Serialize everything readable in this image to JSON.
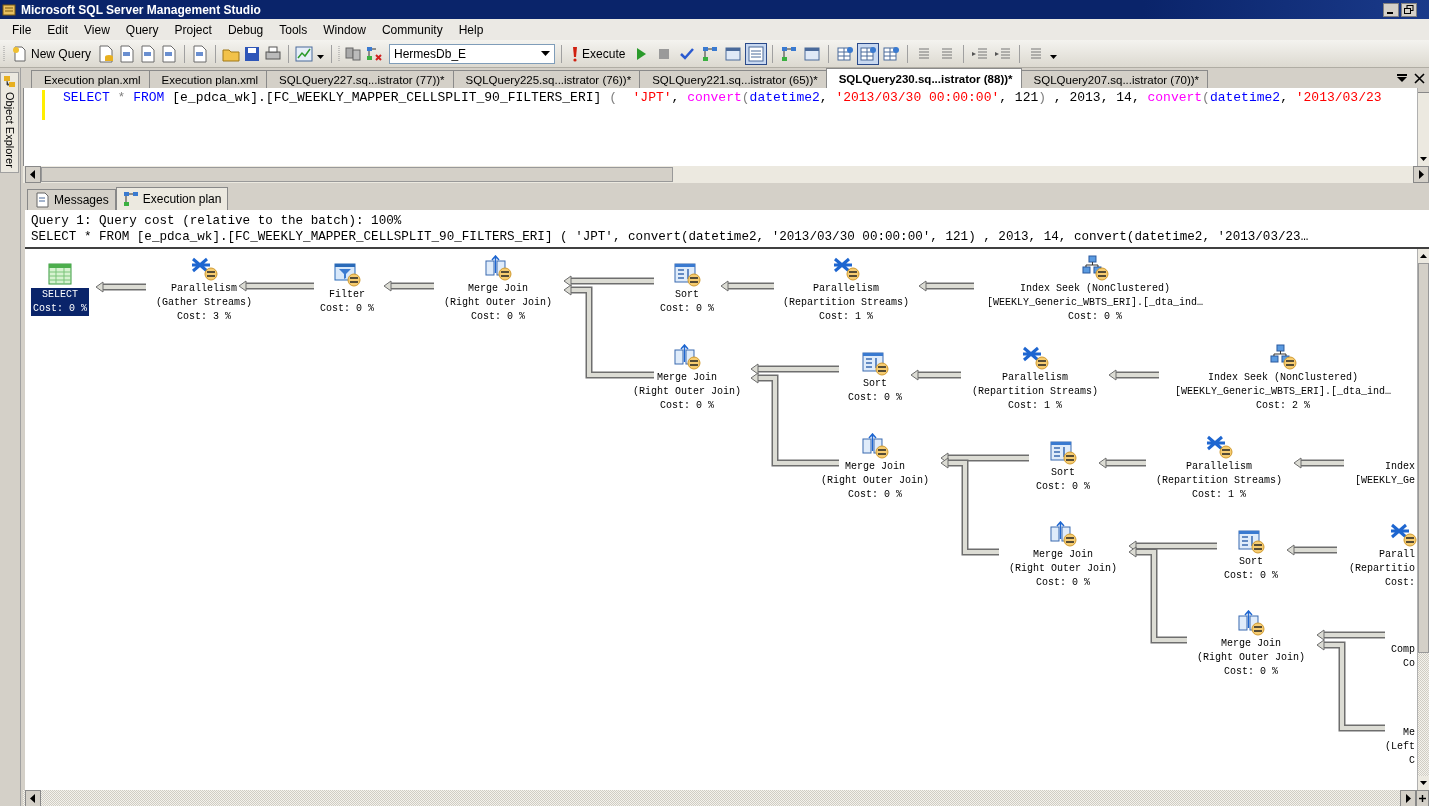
{
  "window": {
    "title": "Microsoft SQL Server Management Studio"
  },
  "menu": [
    "File",
    "Edit",
    "View",
    "Query",
    "Project",
    "Debug",
    "Tools",
    "Window",
    "Community",
    "Help"
  ],
  "toolbar": {
    "new_query": "New Query",
    "database": "HermesDb_E",
    "execute": "Execute"
  },
  "side_panel": {
    "label": "Object Explorer"
  },
  "document_tabs": [
    {
      "label": "Execution plan.xml",
      "selected": false
    },
    {
      "label": "Execution plan.xml",
      "selected": false
    },
    {
      "label": "SQLQuery227.sq...istrator (77))*",
      "selected": false
    },
    {
      "label": "SQLQuery225.sq...istrator (76))*",
      "selected": false
    },
    {
      "label": "SQLQuery221.sq...istrator (65))*",
      "selected": false
    },
    {
      "label": "SQLQuery230.sq...istrator (88))*",
      "selected": true
    },
    {
      "label": "SQLQuery207.sq...istrator (70))*",
      "selected": false
    }
  ],
  "editor": {
    "tokens": [
      {
        "kind": "keyword",
        "text": "SELECT"
      },
      {
        "kind": "operator",
        "text": " * "
      },
      {
        "kind": "keyword",
        "text": "FROM"
      },
      {
        "kind": "plain",
        "text": " [e_pdca_wk].[FC_WEEKLY_MAPPER_CELLSPLIT_90_FILTERS_ERI] "
      },
      {
        "kind": "operator",
        "text": "(  "
      },
      {
        "kind": "string",
        "text": "'JPT'"
      },
      {
        "kind": "plain",
        "text": ", "
      },
      {
        "kind": "function",
        "text": "convert"
      },
      {
        "kind": "operator",
        "text": "("
      },
      {
        "kind": "keyword",
        "text": "datetime2"
      },
      {
        "kind": "plain",
        "text": ", "
      },
      {
        "kind": "string",
        "text": "'2013/03/30 00:00:00'"
      },
      {
        "kind": "plain",
        "text": ", 121"
      },
      {
        "kind": "operator",
        "text": ")"
      },
      {
        "kind": "plain",
        "text": " , 2013, 14, "
      },
      {
        "kind": "function",
        "text": "convert"
      },
      {
        "kind": "operator",
        "text": "("
      },
      {
        "kind": "keyword",
        "text": "datetime2"
      },
      {
        "kind": "plain",
        "text": ", "
      },
      {
        "kind": "string",
        "text": "'2013/03/23"
      }
    ]
  },
  "result_tabs": [
    {
      "label": "Messages",
      "selected": false
    },
    {
      "label": "Execution plan",
      "selected": true
    }
  ],
  "plan": {
    "header": "Query 1: Query cost (relative to the batch): 100%",
    "statement": "SELECT * FROM [e_pdca_wk].[FC_WEEKLY_MAPPER_CELLSPLIT_90_FILTERS_ERI] ( 'JPT', convert(datetime2, '2013/03/30 00:00:00', 121) , 2013, 14, convert(datetime2, '2013/03/23…",
    "nodes": [
      {
        "kind": "select",
        "name": "SELECT",
        "cost": "Cost: 0 %",
        "selected": true,
        "clipped": false
      },
      {
        "kind": "parallelism",
        "name": "Parallelism",
        "detail": "(Gather Streams)",
        "cost": "Cost: 3 %",
        "selected": false,
        "clipped": false
      },
      {
        "kind": "filter",
        "name": "Filter",
        "cost": "Cost: 0 %",
        "selected": false,
        "clipped": false
      },
      {
        "kind": "merge-join",
        "name": "Merge Join",
        "detail": "(Right Outer Join)",
        "cost": "Cost: 0 %",
        "selected": false,
        "clipped": false
      },
      {
        "kind": "sort",
        "name": "Sort",
        "cost": "Cost: 0 %",
        "selected": false,
        "clipped": false
      },
      {
        "kind": "parallelism",
        "name": "Parallelism",
        "detail": "(Repartition Streams)",
        "cost": "Cost: 1 %",
        "selected": false,
        "clipped": false
      },
      {
        "kind": "index-seek",
        "name": "Index Seek (NonClustered)",
        "detail": "[WEEKLY_Generic_WBTS_ERI].[_dta_ind…",
        "cost": "Cost: 0 %",
        "selected": false,
        "clipped": false
      },
      {
        "kind": "merge-join",
        "name": "Merge Join",
        "detail": "(Right Outer Join)",
        "cost": "Cost: 0 %",
        "selected": false,
        "clipped": false
      },
      {
        "kind": "sort",
        "name": "Sort",
        "cost": "Cost: 0 %",
        "selected": false,
        "clipped": false
      },
      {
        "kind": "parallelism",
        "name": "Parallelism",
        "detail": "(Repartition Streams)",
        "cost": "Cost: 1 %",
        "selected": false,
        "clipped": false
      },
      {
        "kind": "index-seek",
        "name": "Index Seek (NonClustered)",
        "detail": "[WEEKLY_Generic_WBTS_ERI].[_dta_ind…",
        "cost": "Cost: 2 %",
        "selected": false,
        "clipped": false
      },
      {
        "kind": "merge-join",
        "name": "Merge Join",
        "detail": "(Right Outer Join)",
        "cost": "Cost: 0 %",
        "selected": false,
        "clipped": false
      },
      {
        "kind": "sort",
        "name": "Sort",
        "cost": "Cost: 0 %",
        "selected": false,
        "clipped": false
      },
      {
        "kind": "parallelism",
        "name": "Parallelism",
        "detail": "(Repartition Streams)",
        "cost": "Cost: 1 %",
        "selected": false,
        "clipped": false
      },
      {
        "name": "Index",
        "detail": "[WEEKLY_Ge",
        "selected": false,
        "clipped": true
      },
      {
        "kind": "merge-join",
        "name": "Merge Join",
        "detail": "(Right Outer Join)",
        "cost": "Cost: 0 %",
        "selected": false,
        "clipped": false
      },
      {
        "kind": "sort",
        "name": "Sort",
        "cost": "Cost: 0 %",
        "selected": false,
        "clipped": false
      },
      {
        "kind": "parallelism",
        "name": "Parall",
        "detail": "(Repartitio",
        "cost": "Cost:",
        "selected": false,
        "clipped": true
      },
      {
        "kind": "merge-join",
        "name": "Merge Join",
        "detail": "(Right Outer Join)",
        "cost": "Cost: 0 %",
        "selected": false,
        "clipped": false
      },
      {
        "name": "Comp",
        "cost": "Co",
        "selected": false,
        "clipped": true
      },
      {
        "name": "Me",
        "detail": "(Left",
        "cost": "C",
        "selected": false,
        "clipped": true
      }
    ]
  }
}
